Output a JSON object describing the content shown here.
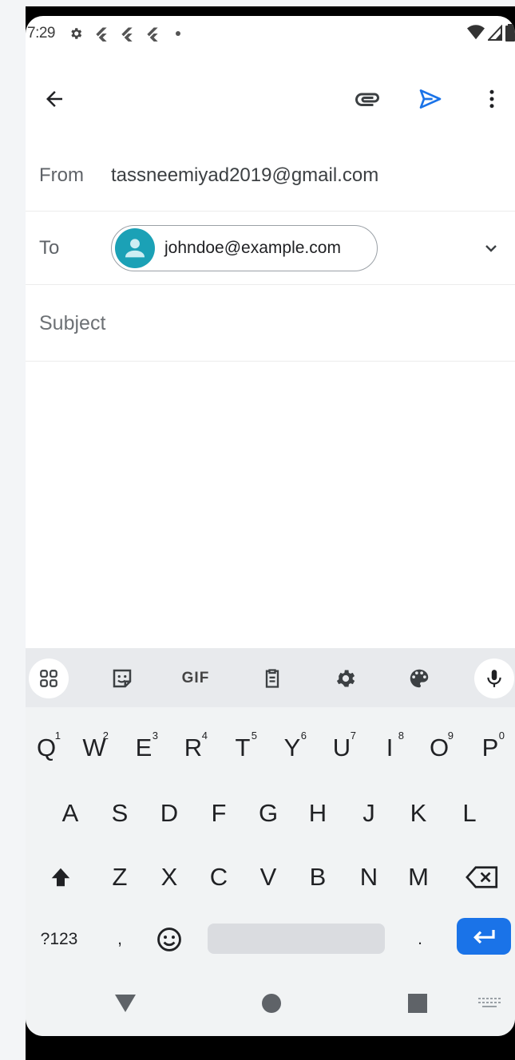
{
  "status_bar": {
    "time": "7:29"
  },
  "compose": {
    "from_label": "From",
    "from_value": "tassneemiyad2019@gmail.com",
    "to_label": "To",
    "to_chip": "johndoe@example.com",
    "subject_placeholder": "Subject"
  },
  "keyboard": {
    "toolbar": {
      "gif_label": "GIF"
    },
    "row1": [
      {
        "k": "Q",
        "n": "1"
      },
      {
        "k": "W",
        "n": "2"
      },
      {
        "k": "E",
        "n": "3"
      },
      {
        "k": "R",
        "n": "4"
      },
      {
        "k": "T",
        "n": "5"
      },
      {
        "k": "Y",
        "n": "6"
      },
      {
        "k": "U",
        "n": "7"
      },
      {
        "k": "I",
        "n": "8"
      },
      {
        "k": "O",
        "n": "9"
      },
      {
        "k": "P",
        "n": "0"
      }
    ],
    "row2": [
      "A",
      "S",
      "D",
      "F",
      "G",
      "H",
      "J",
      "K",
      "L"
    ],
    "row3": [
      "Z",
      "X",
      "C",
      "V",
      "B",
      "N",
      "M"
    ],
    "symbols_label": "?123",
    "comma": ",",
    "period": "."
  },
  "colors": {
    "accent": "#1a73e8",
    "avatar": "#1ba1b6",
    "enter_key": "#1a73e8"
  }
}
